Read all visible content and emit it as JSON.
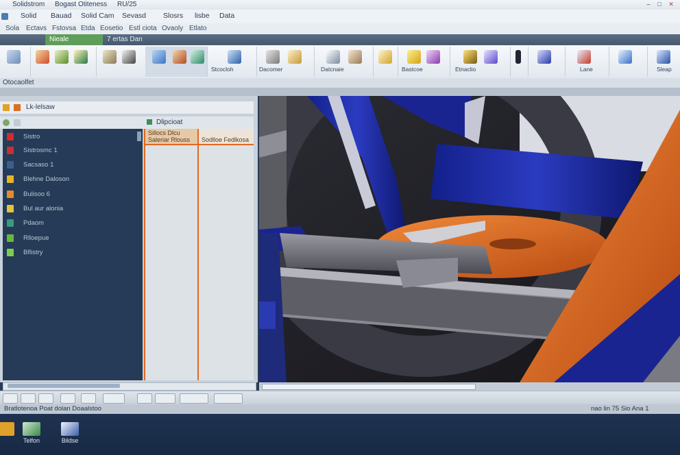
{
  "title": {
    "segments": [
      "Solidstrom",
      "Bogast Otiteness",
      "RU/25"
    ]
  },
  "window_buttons": {
    "minimize": "–",
    "restore": "□",
    "close": "✕"
  },
  "menu": [
    "Solid",
    "Bauad",
    "Solid Cam",
    "Sevasd",
    "Slosrs",
    "lisbe",
    "Data"
  ],
  "submenu": [
    "Sola",
    "Ectavs",
    "Fstovsa",
    "Etda",
    "Eosetio",
    "Estl ciota",
    "Ovaoly",
    "Etlato"
  ],
  "ribbon_tabs": {
    "active": "Nieale",
    "second": "7 ertas Dan"
  },
  "ribbon_labels": [
    "",
    "",
    "",
    "",
    "Stcocloh",
    "Dacomer",
    "Datcnaie",
    "",
    "Bastcoe",
    "Etnaclio",
    "",
    "",
    "",
    "Lane",
    "",
    "Sleap"
  ],
  "panel_title": "Otocaolfet",
  "left_panel": {
    "header": "Lk-lelsaw",
    "tab": "Dlipcioat",
    "tree_items": [
      "Sistro",
      "Sistrosmc 1",
      "Sacsaso 1",
      "Blehne Daloson",
      "Bulisoo 6",
      "Bul aur alonia",
      "Pdaom",
      "Rlloepue",
      "Bflistry"
    ]
  },
  "prop_columns": [
    {
      "line1": "Sillocs Dlcu",
      "line2": "Saleriar Rlouss"
    },
    {
      "line1": "",
      "line2": "Sodlloe Fedlkosa"
    }
  ],
  "statusbar": {
    "left": "Bratlotenoa Poat dolan Doaalstoo",
    "right": "nao lin 75   Sio Ana 1"
  },
  "taskbar": [
    {
      "label": ""
    },
    {
      "label": "Telfon"
    },
    {
      "label": "Bildse"
    }
  ],
  "colors": {
    "accent_green": "#5f9e5a",
    "accent_orange": "#e0681f",
    "model_blue": "#1f2f9a",
    "tree_bg": "#263b57"
  }
}
